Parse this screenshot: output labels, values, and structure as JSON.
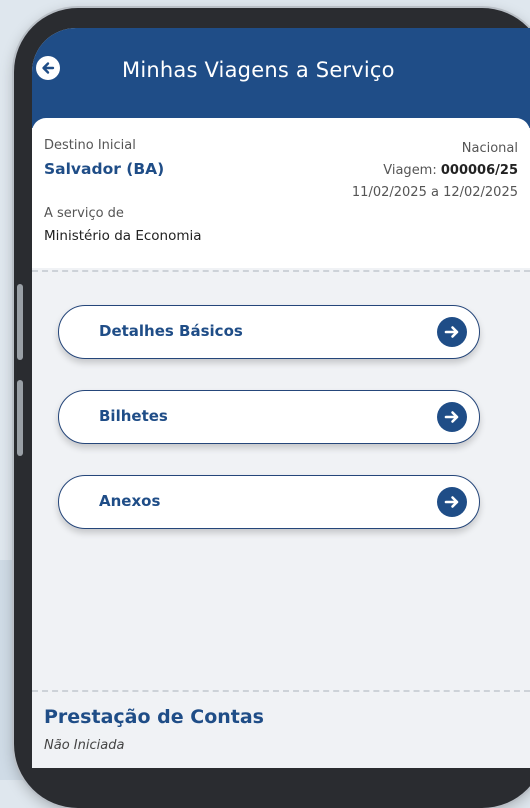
{
  "header": {
    "title": "Minhas Viagens a Serviço"
  },
  "trip": {
    "destination_label": "Destino Inicial",
    "destination": "Salvador (BA)",
    "type": "Nacional",
    "trip_prefix": "Viagem: ",
    "trip_number": "000006/25",
    "dates": "11/02/2025 a 12/02/2025",
    "service_label": "A serviço de",
    "service_value": "Ministério da Economia"
  },
  "menu": [
    {
      "label": "Detalhes Básicos",
      "icon": "arrow-right-circle-icon"
    },
    {
      "label": "Bilhetes",
      "icon": "arrow-right-circle-icon"
    },
    {
      "label": "Anexos",
      "icon": "arrow-right-circle-icon"
    }
  ],
  "accounts": {
    "title": "Prestação de Contas",
    "status": "Não Iniciada"
  },
  "colors": {
    "primary": "#1f4d87",
    "background": "#f0f2f5",
    "card": "#ffffff"
  }
}
